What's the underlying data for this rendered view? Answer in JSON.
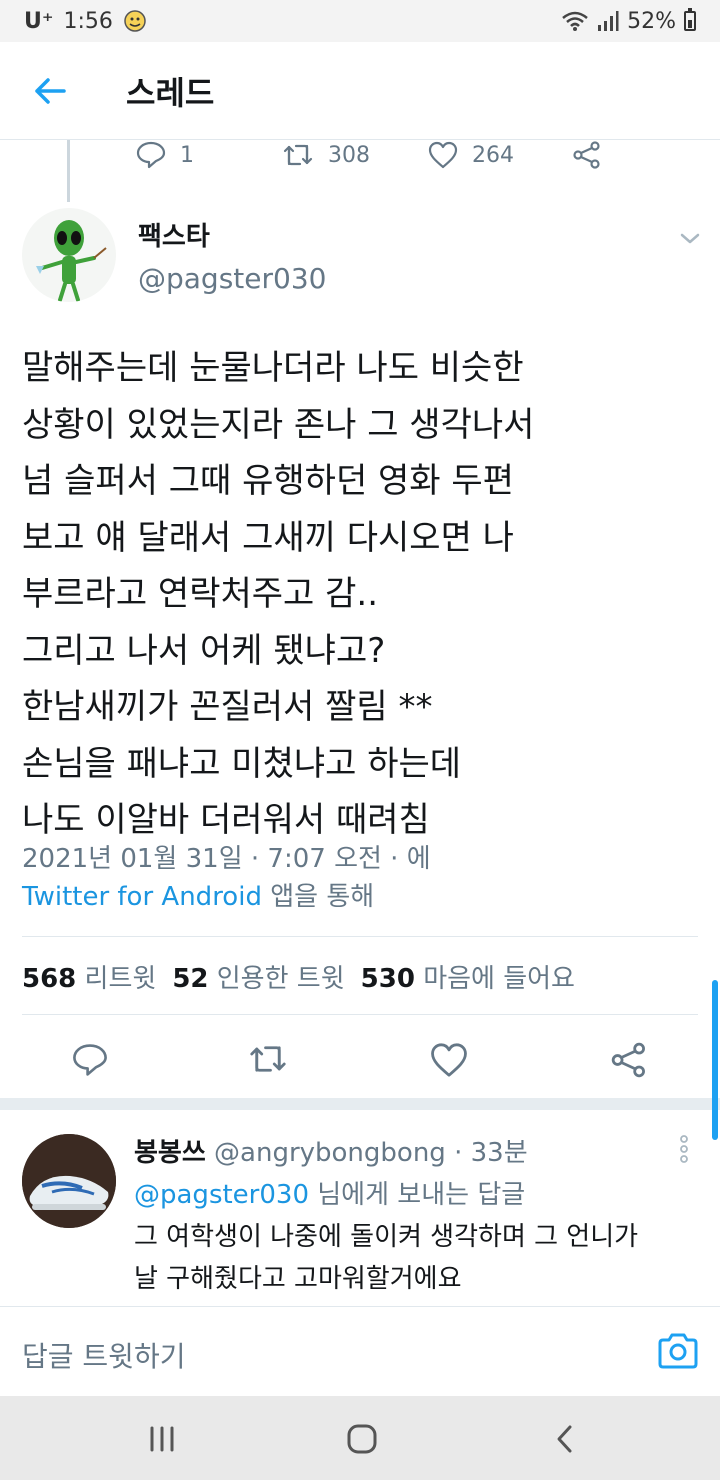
{
  "status_bar": {
    "carrier": "U⁺",
    "time": "1:56",
    "battery": "52%"
  },
  "header": {
    "title": "스레드"
  },
  "prev_tweet_actions": {
    "replies": "1",
    "retweets": "308",
    "likes": "264"
  },
  "tweet": {
    "author_name": "팩스타",
    "author_handle": "@pagster030",
    "text": "말해주는데 눈물나더라 나도 비슷한\n상황이 있었는지라 존나 그 생각나서\n넘 슬퍼서 그때 유행하던 영화 두편\n보고 얘 달래서 그새끼 다시오면 나\n부르라고 연락처주고 감..\n그리고 나서 어케 됐냐고?\n한남새끼가 꼰질러서 짤림 **\n손님을 패냐고 미쳤냐고 하는데\n나도 이알바 더러워서 때려침",
    "timestamp": "2021년 01월 31일 · 7:07 오전 · 에",
    "source_link": "Twitter for Android",
    "source_suffix": " 앱을 통해"
  },
  "stats": {
    "retweets_count": "568",
    "retweets_label": "리트윗",
    "quotes_count": "52",
    "quotes_label": "인용한 트윗",
    "likes_count": "530",
    "likes_label": "마음에 들어요"
  },
  "reply": {
    "name": "봉봉쓰",
    "handle": "@angrybongbong",
    "time": "· 33분",
    "mention": "@pagster030",
    "reply_to_suffix": " 님에게 보내는 답글",
    "text": "그 여학생이 나중에 돌이켜 생각하며 그 언니가\n날 구해줬다고 고마워할거에요"
  },
  "compose": {
    "placeholder": "답글 트윗하기"
  },
  "colors": {
    "accent": "#1b95e0",
    "secondary_text": "#657786",
    "divider": "#e1e8ed"
  },
  "icons": [
    "back-arrow-icon",
    "reply-icon",
    "retweet-icon",
    "like-icon",
    "share-icon",
    "chevron-down-icon",
    "more-vertical-icon",
    "camera-icon"
  ]
}
